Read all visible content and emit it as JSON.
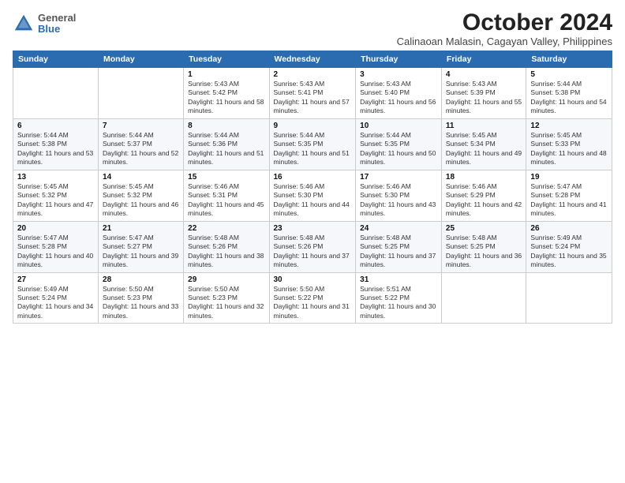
{
  "logo": {
    "general": "General",
    "blue": "Blue"
  },
  "title": "October 2024",
  "subtitle": "Calinaoan Malasin, Cagayan Valley, Philippines",
  "days_of_week": [
    "Sunday",
    "Monday",
    "Tuesday",
    "Wednesday",
    "Thursday",
    "Friday",
    "Saturday"
  ],
  "weeks": [
    [
      {
        "day": null
      },
      {
        "day": null
      },
      {
        "day": "1",
        "sunrise": "Sunrise: 5:43 AM",
        "sunset": "Sunset: 5:42 PM",
        "daylight": "Daylight: 11 hours and 58 minutes."
      },
      {
        "day": "2",
        "sunrise": "Sunrise: 5:43 AM",
        "sunset": "Sunset: 5:41 PM",
        "daylight": "Daylight: 11 hours and 57 minutes."
      },
      {
        "day": "3",
        "sunrise": "Sunrise: 5:43 AM",
        "sunset": "Sunset: 5:40 PM",
        "daylight": "Daylight: 11 hours and 56 minutes."
      },
      {
        "day": "4",
        "sunrise": "Sunrise: 5:43 AM",
        "sunset": "Sunset: 5:39 PM",
        "daylight": "Daylight: 11 hours and 55 minutes."
      },
      {
        "day": "5",
        "sunrise": "Sunrise: 5:44 AM",
        "sunset": "Sunset: 5:38 PM",
        "daylight": "Daylight: 11 hours and 54 minutes."
      }
    ],
    [
      {
        "day": "6",
        "sunrise": "Sunrise: 5:44 AM",
        "sunset": "Sunset: 5:38 PM",
        "daylight": "Daylight: 11 hours and 53 minutes."
      },
      {
        "day": "7",
        "sunrise": "Sunrise: 5:44 AM",
        "sunset": "Sunset: 5:37 PM",
        "daylight": "Daylight: 11 hours and 52 minutes."
      },
      {
        "day": "8",
        "sunrise": "Sunrise: 5:44 AM",
        "sunset": "Sunset: 5:36 PM",
        "daylight": "Daylight: 11 hours and 51 minutes."
      },
      {
        "day": "9",
        "sunrise": "Sunrise: 5:44 AM",
        "sunset": "Sunset: 5:35 PM",
        "daylight": "Daylight: 11 hours and 51 minutes."
      },
      {
        "day": "10",
        "sunrise": "Sunrise: 5:44 AM",
        "sunset": "Sunset: 5:35 PM",
        "daylight": "Daylight: 11 hours and 50 minutes."
      },
      {
        "day": "11",
        "sunrise": "Sunrise: 5:45 AM",
        "sunset": "Sunset: 5:34 PM",
        "daylight": "Daylight: 11 hours and 49 minutes."
      },
      {
        "day": "12",
        "sunrise": "Sunrise: 5:45 AM",
        "sunset": "Sunset: 5:33 PM",
        "daylight": "Daylight: 11 hours and 48 minutes."
      }
    ],
    [
      {
        "day": "13",
        "sunrise": "Sunrise: 5:45 AM",
        "sunset": "Sunset: 5:32 PM",
        "daylight": "Daylight: 11 hours and 47 minutes."
      },
      {
        "day": "14",
        "sunrise": "Sunrise: 5:45 AM",
        "sunset": "Sunset: 5:32 PM",
        "daylight": "Daylight: 11 hours and 46 minutes."
      },
      {
        "day": "15",
        "sunrise": "Sunrise: 5:46 AM",
        "sunset": "Sunset: 5:31 PM",
        "daylight": "Daylight: 11 hours and 45 minutes."
      },
      {
        "day": "16",
        "sunrise": "Sunrise: 5:46 AM",
        "sunset": "Sunset: 5:30 PM",
        "daylight": "Daylight: 11 hours and 44 minutes."
      },
      {
        "day": "17",
        "sunrise": "Sunrise: 5:46 AM",
        "sunset": "Sunset: 5:30 PM",
        "daylight": "Daylight: 11 hours and 43 minutes."
      },
      {
        "day": "18",
        "sunrise": "Sunrise: 5:46 AM",
        "sunset": "Sunset: 5:29 PM",
        "daylight": "Daylight: 11 hours and 42 minutes."
      },
      {
        "day": "19",
        "sunrise": "Sunrise: 5:47 AM",
        "sunset": "Sunset: 5:28 PM",
        "daylight": "Daylight: 11 hours and 41 minutes."
      }
    ],
    [
      {
        "day": "20",
        "sunrise": "Sunrise: 5:47 AM",
        "sunset": "Sunset: 5:28 PM",
        "daylight": "Daylight: 11 hours and 40 minutes."
      },
      {
        "day": "21",
        "sunrise": "Sunrise: 5:47 AM",
        "sunset": "Sunset: 5:27 PM",
        "daylight": "Daylight: 11 hours and 39 minutes."
      },
      {
        "day": "22",
        "sunrise": "Sunrise: 5:48 AM",
        "sunset": "Sunset: 5:26 PM",
        "daylight": "Daylight: 11 hours and 38 minutes."
      },
      {
        "day": "23",
        "sunrise": "Sunrise: 5:48 AM",
        "sunset": "Sunset: 5:26 PM",
        "daylight": "Daylight: 11 hours and 37 minutes."
      },
      {
        "day": "24",
        "sunrise": "Sunrise: 5:48 AM",
        "sunset": "Sunset: 5:25 PM",
        "daylight": "Daylight: 11 hours and 37 minutes."
      },
      {
        "day": "25",
        "sunrise": "Sunrise: 5:48 AM",
        "sunset": "Sunset: 5:25 PM",
        "daylight": "Daylight: 11 hours and 36 minutes."
      },
      {
        "day": "26",
        "sunrise": "Sunrise: 5:49 AM",
        "sunset": "Sunset: 5:24 PM",
        "daylight": "Daylight: 11 hours and 35 minutes."
      }
    ],
    [
      {
        "day": "27",
        "sunrise": "Sunrise: 5:49 AM",
        "sunset": "Sunset: 5:24 PM",
        "daylight": "Daylight: 11 hours and 34 minutes."
      },
      {
        "day": "28",
        "sunrise": "Sunrise: 5:50 AM",
        "sunset": "Sunset: 5:23 PM",
        "daylight": "Daylight: 11 hours and 33 minutes."
      },
      {
        "day": "29",
        "sunrise": "Sunrise: 5:50 AM",
        "sunset": "Sunset: 5:23 PM",
        "daylight": "Daylight: 11 hours and 32 minutes."
      },
      {
        "day": "30",
        "sunrise": "Sunrise: 5:50 AM",
        "sunset": "Sunset: 5:22 PM",
        "daylight": "Daylight: 11 hours and 31 minutes."
      },
      {
        "day": "31",
        "sunrise": "Sunrise: 5:51 AM",
        "sunset": "Sunset: 5:22 PM",
        "daylight": "Daylight: 11 hours and 30 minutes."
      },
      {
        "day": null
      },
      {
        "day": null
      }
    ]
  ]
}
